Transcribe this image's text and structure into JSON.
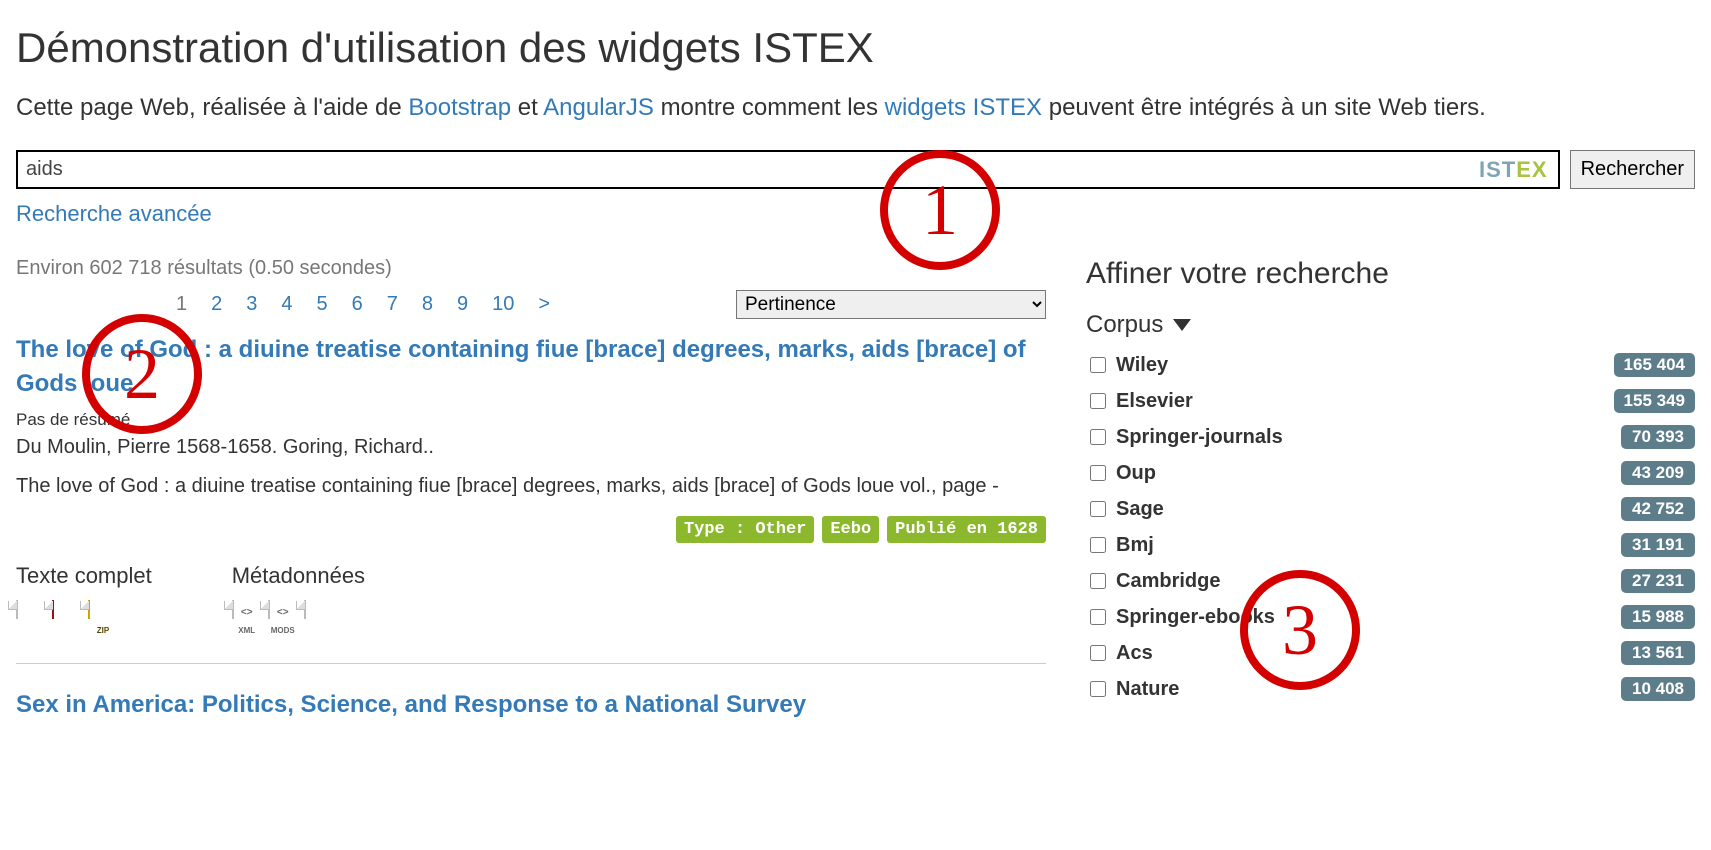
{
  "page_title": "Démonstration d'utilisation des widgets ISTEX",
  "intro": {
    "prefix": "Cette page Web, réalisée à l'aide de ",
    "link_bootstrap": "Bootstrap",
    "mid1": " et ",
    "link_angular": "AngularJS",
    "mid2": " montre comment les ",
    "link_widgets": "widgets ISTEX",
    "suffix": " peuvent être intégrés à un site Web tiers."
  },
  "search": {
    "value": "aids",
    "logo_ist": "IST",
    "logo_ex": "EX",
    "button": "Rechercher",
    "advanced": "Recherche avancée"
  },
  "results": {
    "count_text": "Environ 602 718 résultats (0.50 secondes)",
    "pages": [
      "1",
      "2",
      "3",
      "4",
      "5",
      "6",
      "7",
      "8",
      "9",
      "10",
      ">"
    ],
    "current_page": "1",
    "sort_value": "Pertinence"
  },
  "result1": {
    "title": "The love of God : a diuine treatise containing fiue [brace] degrees, marks, aids [brace] of Gods loue",
    "no_abstract": "Pas de résumé",
    "authors": "Du Moulin, Pierre 1568-1658. Goring, Richard..",
    "source": "The love of God : a diuine treatise containing fiue [brace] degrees, marks, aids [brace] of Gods loue vol., page -",
    "tags": [
      "Type : Other",
      "Eebo",
      "Publié en 1628"
    ],
    "fulltext_label": "Texte complet",
    "metadata_label": "Métadonnées",
    "fulltext_icons": [
      {
        "kind": "plain",
        "label": ""
      },
      {
        "kind": "pdf",
        "label": "PDF"
      },
      {
        "kind": "zip",
        "label": "ZIP"
      }
    ],
    "metadata_icons": [
      {
        "kind": "xml",
        "label": "XML",
        "code": "<>"
      },
      {
        "kind": "mods",
        "label": "MODS",
        "code": "<>"
      },
      {
        "kind": "plain",
        "label": ""
      }
    ]
  },
  "result2": {
    "title": "Sex in America: Politics, Science, and Response to a National Survey"
  },
  "facets": {
    "title": "Affiner votre recherche",
    "group_label": "Corpus",
    "items": [
      {
        "label": "Wiley",
        "count": "165 404"
      },
      {
        "label": "Elsevier",
        "count": "155 349"
      },
      {
        "label": "Springer-journals",
        "count": "70 393"
      },
      {
        "label": "Oup",
        "count": "43 209"
      },
      {
        "label": "Sage",
        "count": "42 752"
      },
      {
        "label": "Bmj",
        "count": "31 191"
      },
      {
        "label": "Cambridge",
        "count": "27 231"
      },
      {
        "label": "Springer-ebooks",
        "count": "15 988"
      },
      {
        "label": "Acs",
        "count": "13 561"
      },
      {
        "label": "Nature",
        "count": "10 408"
      }
    ]
  },
  "annotations": {
    "a1": "1",
    "a2": "2",
    "a3": "3"
  }
}
